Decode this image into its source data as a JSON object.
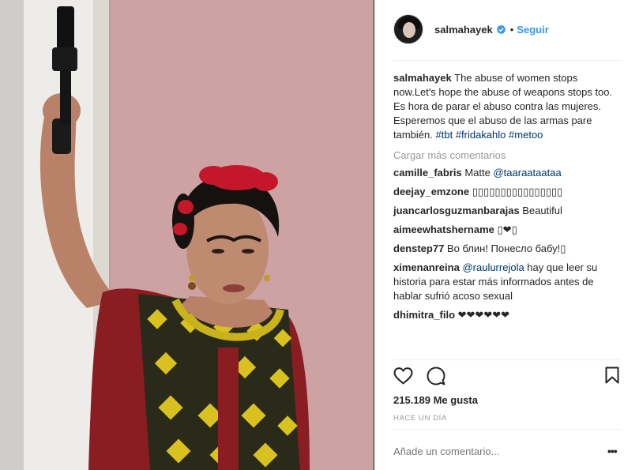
{
  "header": {
    "username": "salmahayek",
    "dot": "•",
    "follow_label": "Seguir"
  },
  "post": {
    "caption_user": "salmahayek",
    "caption_text": "The abuse of women stops now.Let's hope the abuse of weapons stops too. Es hora de parar el abuso contra las mujeres. Esperemos que el abuso de las armas pare también.",
    "hashtags": [
      "#tbt",
      "#fridakahlo",
      "#metoo"
    ]
  },
  "load_more_label": "Cargar más comentarios",
  "comments": [
    {
      "user": "camille_fabris",
      "text": "Matte ",
      "mention": "@taaraataataa"
    },
    {
      "user": "deejay_emzone",
      "text": "▯▯▯▯▯▯▯▯▯▯▯▯▯▯▯▯"
    },
    {
      "user": "juancarlosguzmanbarajas",
      "text": "Beautiful"
    },
    {
      "user": "aimeewhatshername",
      "text": "▯❤▯"
    },
    {
      "user": "denstep77",
      "text": "Во блин! Понесло бабу!▯"
    },
    {
      "user": "ximenanreina",
      "text": " hay que leer su historia para estar más informados antes de hablar sufrió acoso sexual",
      "mention": "@raulurrejola"
    },
    {
      "user": "dhimitra_filo",
      "text": "❤❤❤❤❤❤"
    }
  ],
  "likes_label": "215.189 Me gusta",
  "time_label": "HACE UN DÍA",
  "add_comment_placeholder": "Añade un comentario...",
  "options_label": "•••",
  "colors": {
    "link_blue": "#3897f0",
    "hashtag": "#003569",
    "muted": "#999999",
    "wall_pink": "#c99d9e"
  },
  "icons": [
    "heart-icon",
    "comment-icon",
    "bookmark-icon",
    "verified-badge-icon"
  ]
}
